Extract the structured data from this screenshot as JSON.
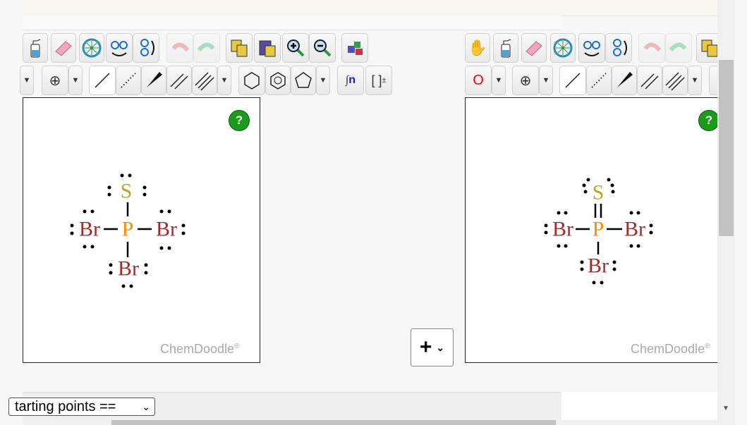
{
  "colors": {
    "phosphorus": "#ff8c00",
    "sulfur": "#b8a42a",
    "bromine": "#a52a2a",
    "help": "#1a9b1a",
    "charge_o": "#ff0000"
  },
  "editors": [
    {
      "brand": "ChemDoodle",
      "brand_mark": "®",
      "help": "?",
      "atoms": {
        "s": "S",
        "p": "P",
        "br_left": "Br",
        "br_right": "Br",
        "br_bottom": "Br"
      },
      "ps_bond": "single"
    },
    {
      "brand": "ChemDoodle",
      "brand_mark": "®",
      "help": "?",
      "charge_label": "O",
      "atoms": {
        "s": "S",
        "p": "P",
        "br_left": "Br",
        "br_right": "Br",
        "br_bottom": "Br"
      },
      "ps_bond": "double"
    }
  ],
  "add_button": {
    "label": "+",
    "caret": "⌄"
  },
  "select": {
    "value": "tarting points =="
  },
  "toolbar_icons": [
    "hand-icon",
    "clear-bottle-icon",
    "eraser-icon",
    "center-icon",
    "flip-horizontal-icon",
    "flip-vertical-icon",
    "undo-icon",
    "redo-icon",
    "copy-icon",
    "paste-icon",
    "zoom-in-icon",
    "zoom-out-icon",
    "templates-icon",
    "charge-icon",
    "single-bond-icon",
    "dashed-bond-icon",
    "wedge-bond-icon",
    "double-bond-icon",
    "triple-bond-icon",
    "cyclohexane-icon",
    "benzene-icon",
    "cyclopentane-icon",
    "repeat-unit-icon",
    "bracket-charge-icon"
  ]
}
